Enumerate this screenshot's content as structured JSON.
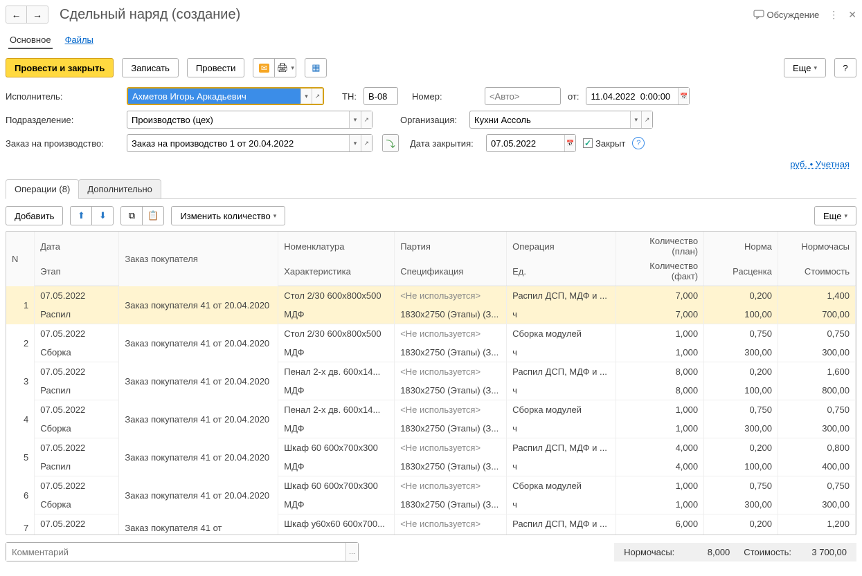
{
  "header": {
    "title": "Сдельный наряд (создание)",
    "discuss": "Обсуждение"
  },
  "mainTabs": {
    "primary": "Основное",
    "files": "Файлы"
  },
  "toolbar": {
    "post_close": "Провести и закрыть",
    "write": "Записать",
    "post": "Провести",
    "more": "Еще"
  },
  "form": {
    "performer_label": "Исполнитель:",
    "performer_value": "Ахметов Игорь Аркадьевич",
    "tn_label": "ТН:",
    "tn_value": "В-08",
    "num_label": "Номер:",
    "num_placeholder": "<Авто>",
    "from_label": "от:",
    "from_value": "11.04.2022  0:00:00",
    "dept_label": "Подразделение:",
    "dept_value": "Производство (цех)",
    "org_label": "Организация:",
    "org_value": "Кухни Ассоль",
    "order_label": "Заказ на производство:",
    "order_value": "Заказ на производство 1 от 20.04.2022",
    "close_date_label": "Дата закрытия:",
    "close_date_value": "07.05.2022",
    "closed_label": "Закрыт",
    "price_link": "руб. • Учетная"
  },
  "subTabs": {
    "ops": "Операции (8)",
    "extra": "Дополнительно"
  },
  "tableToolbar": {
    "add": "Добавить",
    "change_qty": "Изменить количество",
    "more": "Еще"
  },
  "columns": {
    "n": "N",
    "date": "Дата",
    "stage": "Этап",
    "cust_order": "Заказ покупателя",
    "nom": "Номенклатура",
    "char": "Характеристика",
    "party": "Партия",
    "spec": "Спецификация",
    "op": "Операция",
    "unit": "Ед.",
    "qty_plan": "Количество (план)",
    "qty_fact": "Количество (факт)",
    "norm": "Норма",
    "rate": "Расценка",
    "nh": "Нормочасы",
    "cost": "Стоимость"
  },
  "rows": [
    {
      "n": "1",
      "date": "07.05.2022",
      "stage": "Распил",
      "order": "Заказ покупателя 41 от 20.04.2020",
      "nom": "Стол 2/30 600x800x500",
      "char": "МДФ",
      "party": "<Не используется>",
      "spec": "1830x2750 (Этапы) (З...",
      "op": "Распил ДСП, МДФ и ...",
      "unit": "ч",
      "qp": "7,000",
      "qf": "7,000",
      "norm": "0,200",
      "rate": "100,00",
      "nh": "1,400",
      "cost": "700,00",
      "sel": true
    },
    {
      "n": "2",
      "date": "07.05.2022",
      "stage": "Сборка",
      "order": "Заказ покупателя 41 от 20.04.2020",
      "nom": "Стол 2/30 600x800x500",
      "char": "МДФ",
      "party": "<Не используется>",
      "spec": "1830x2750 (Этапы) (З...",
      "op": "Сборка модулей",
      "unit": "ч",
      "qp": "1,000",
      "qf": "1,000",
      "norm": "0,750",
      "rate": "300,00",
      "nh": "0,750",
      "cost": "300,00"
    },
    {
      "n": "3",
      "date": "07.05.2022",
      "stage": "Распил",
      "order": "Заказ покупателя 41 от 20.04.2020",
      "nom": "Пенал 2-х дв. 600x14...",
      "char": "МДФ",
      "party": "<Не используется>",
      "spec": "1830x2750 (Этапы) (З...",
      "op": "Распил ДСП, МДФ и ...",
      "unit": "ч",
      "qp": "8,000",
      "qf": "8,000",
      "norm": "0,200",
      "rate": "100,00",
      "nh": "1,600",
      "cost": "800,00"
    },
    {
      "n": "4",
      "date": "07.05.2022",
      "stage": "Сборка",
      "order": "Заказ покупателя 41 от 20.04.2020",
      "nom": "Пенал 2-х дв. 600x14...",
      "char": "МДФ",
      "party": "<Не используется>",
      "spec": "1830x2750 (Этапы) (З...",
      "op": "Сборка модулей",
      "unit": "ч",
      "qp": "1,000",
      "qf": "1,000",
      "norm": "0,750",
      "rate": "300,00",
      "nh": "0,750",
      "cost": "300,00"
    },
    {
      "n": "5",
      "date": "07.05.2022",
      "stage": "Распил",
      "order": "Заказ покупателя 41 от 20.04.2020",
      "nom": "Шкаф 60 600x700x300",
      "char": "МДФ",
      "party": "<Не используется>",
      "spec": "1830x2750 (Этапы) (З...",
      "op": "Распил ДСП, МДФ и ...",
      "unit": "ч",
      "qp": "4,000",
      "qf": "4,000",
      "norm": "0,200",
      "rate": "100,00",
      "nh": "0,800",
      "cost": "400,00"
    },
    {
      "n": "6",
      "date": "07.05.2022",
      "stage": "Сборка",
      "order": "Заказ покупателя 41 от 20.04.2020",
      "nom": "Шкаф 60 600x700x300",
      "char": "МДФ",
      "party": "<Не используется>",
      "spec": "1830x2750 (Этапы) (З...",
      "op": "Сборка модулей",
      "unit": "ч",
      "qp": "1,000",
      "qf": "1,000",
      "norm": "0,750",
      "rate": "300,00",
      "nh": "0,750",
      "cost": "300,00"
    },
    {
      "n": "7",
      "date": "07.05.2022",
      "stage": "",
      "order": "Заказ покупателя 41 от",
      "nom": "Шкаф у60x60 600x700...",
      "char": "",
      "party": "<Не используется>",
      "spec": "",
      "op": "Распил ДСП, МДФ и ...",
      "unit": "",
      "qp": "6,000",
      "qf": "",
      "norm": "0,200",
      "rate": "",
      "nh": "1,200",
      "cost": ""
    }
  ],
  "footer": {
    "comment_placeholder": "Комментарий",
    "nh_label": "Нормочасы:",
    "nh_value": "8,000",
    "cost_label": "Стоимость:",
    "cost_value": "3 700,00"
  }
}
